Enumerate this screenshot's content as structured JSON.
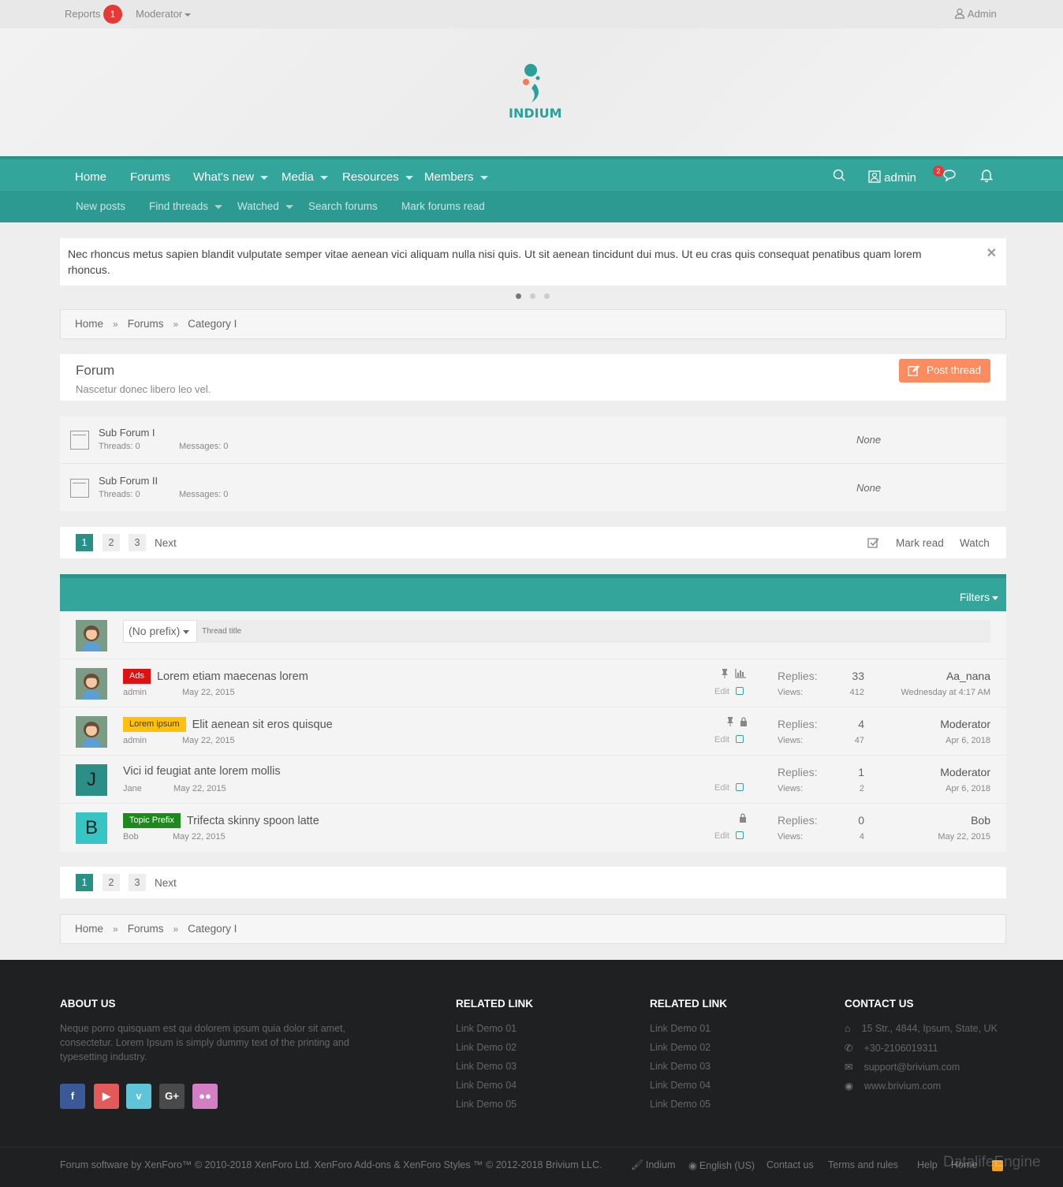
{
  "topbar": {
    "reports": "Reports",
    "reports_count": "1",
    "moderator": "Moderator",
    "admin": "Admin"
  },
  "logo": {
    "text": "INDIUM"
  },
  "nav": {
    "items": [
      {
        "label": "Home"
      },
      {
        "label": "Forums"
      },
      {
        "label": "What's new"
      },
      {
        "label": "Media"
      },
      {
        "label": "Resources"
      },
      {
        "label": "Members"
      }
    ],
    "user": "admin",
    "conversations_count": "2"
  },
  "subnav": {
    "items": [
      {
        "label": "New posts"
      },
      {
        "label": "Find threads"
      },
      {
        "label": "Watched"
      },
      {
        "label": "Search forums"
      },
      {
        "label": "Mark forums read"
      }
    ]
  },
  "notice": {
    "text": "Nec rhoncus metus sapien blandit vulputate semper vitae aenean vici aliquam nulla nisi quis. Ut sit aenean tincidunt dui mus. Ut eu cras quis consequat penatibus quam lorem rhoncus."
  },
  "breadcrumb": [
    "Home",
    "Forums",
    "Category I"
  ],
  "forum": {
    "title": "Forum",
    "description": "Nascetur donec libero leo vel.",
    "post_thread": "Post thread"
  },
  "subforums": [
    {
      "title": "Sub Forum I",
      "threads": "Threads: 0",
      "messages": "Messages: 0",
      "last": "None"
    },
    {
      "title": "Sub Forum II",
      "threads": "Threads: 0",
      "messages": "Messages: 0",
      "last": "None"
    }
  ],
  "pagination": {
    "pages": [
      "1",
      "2",
      "3"
    ],
    "next": "Next",
    "mark_read": "Mark read",
    "watch": "Watch"
  },
  "thread_list": {
    "filters": "Filters",
    "prefix_select": "(No prefix)",
    "title_placeholder": "Thread title",
    "replies_label": "Replies:",
    "views_label": "Views:",
    "edit_label": "Edit",
    "threads": [
      {
        "prefix": "Ads",
        "title": "Lorem etiam maecenas lorem",
        "author": "admin",
        "date": "May 22, 2015",
        "replies": "33",
        "views": "412",
        "last_user": "Aa_nana",
        "last_date": "Wednesday at 4:17 AM"
      },
      {
        "prefix": "Lorem ipsum",
        "title": "Elit aenean sit eros quisque",
        "author": "admin",
        "date": "May 22, 2015",
        "replies": "4",
        "views": "47",
        "last_user": "Moderator",
        "last_date": "Apr 6, 2018"
      },
      {
        "prefix": "",
        "title": "Vici id feugiat ante lorem mollis",
        "author": "Jane",
        "date": "May 22, 2015",
        "replies": "1",
        "views": "2",
        "last_user": "Moderator",
        "last_date": "Apr 6, 2018",
        "avatar_letter": "J"
      },
      {
        "prefix": "Topic Prefix",
        "title": "Trifecta skinny spoon latte",
        "author": "Bob",
        "date": "May 22, 2015",
        "replies": "0",
        "views": "4",
        "last_user": "Bob",
        "last_date": "May 22, 2015",
        "avatar_letter": "B"
      }
    ]
  },
  "footer": {
    "about_title": "ABOUT US",
    "about_text": "Neque porro quisquam est qui dolorem ipsum quia dolor sit amet, consectetur. Lorem Ipsum is simply dummy text of the printing and typesetting industry.",
    "related_title": "RELATED LINK",
    "links": [
      "Link Demo 01",
      "Link Demo 02",
      "Link Demo 03",
      "Link Demo 04",
      "Link Demo 05"
    ],
    "contact_title": "CONTACT US",
    "contact": [
      "15 Str., 4844, Ipsum, State, UK",
      "+30-2106019311",
      "support@brivium.com",
      "www.brivium.com"
    ],
    "copyright": "Forum software by XenForo™ © 2010-2018 XenForo Ltd. XenForo Add-ons & XenForo Styles ™ © 2012-2018 Brivium LLC.",
    "bottom_links": [
      "Indium",
      "English (US)",
      "Contact us",
      "Terms and rules",
      "Help",
      "Home"
    ],
    "watermark": "DatalifeEngine"
  },
  "colors": {
    "accent": "#33a59a",
    "post_button": "#fd8b60",
    "prefix_ads": "#e01010",
    "prefix_lorem": "#ffc107",
    "prefix_topic": "#1e8a1e"
  }
}
